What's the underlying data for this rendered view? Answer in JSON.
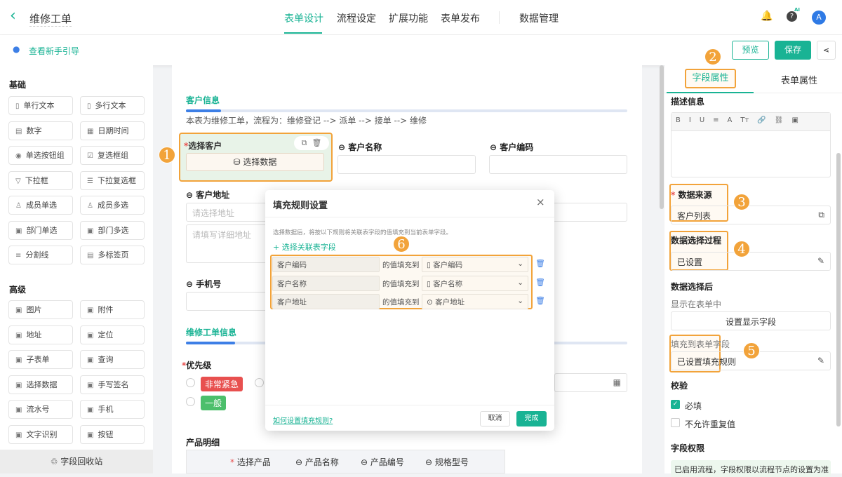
{
  "header": {
    "title": "维修工单",
    "tabs": [
      "表单设计",
      "流程设定",
      "扩展功能",
      "表单发布",
      "数据管理"
    ],
    "avatar": "A",
    "ai_badge": "AI"
  },
  "subheader": {
    "guide": "查看新手引导",
    "preview": "预览",
    "save": "保存"
  },
  "sidebar": {
    "basic_title": "基础",
    "basic": [
      [
        "单行文本",
        "多行文本"
      ],
      [
        "数字",
        "日期时间"
      ],
      [
        "单选按钮组",
        "复选框组"
      ],
      [
        "下拉框",
        "下拉复选框"
      ],
      [
        "成员单选",
        "成员多选"
      ],
      [
        "部门单选",
        "部门多选"
      ],
      [
        "分割线",
        "多标签页"
      ]
    ],
    "advanced_title": "高级",
    "advanced": [
      [
        "图片",
        "附件"
      ],
      [
        "地址",
        "定位"
      ],
      [
        "子表单",
        "查询"
      ],
      [
        "选择数据",
        "手写签名"
      ],
      [
        "流水号",
        "手机"
      ],
      [
        "文字识别",
        "按钮"
      ]
    ],
    "recycle": "字段回收站"
  },
  "form": {
    "section1": "客户信息",
    "desc": "本表为维修工单，流程为：维修登记 --> 派单 --> 接单 --> 维修",
    "select_customer": "选择客户",
    "select_data": "选择数据",
    "customer_name": "客户名称",
    "customer_code": "客户编码",
    "address": "客户地址",
    "address_ph": "请选择地址",
    "detail_ph": "请填写详细地址",
    "phone": "手机号",
    "section2": "维修工单信息",
    "priority": "优先级",
    "p_urgent": "非常紧急",
    "p_normal": "一般",
    "products": "产品明细",
    "product_cols": [
      "选择产品",
      "产品名称",
      "产品编号",
      "规格型号"
    ]
  },
  "modal": {
    "title": "填充规则设置",
    "hint": "选择数据后，将按以下规则将关联表字段的值填充到当前表单字段。",
    "add": "选择关联表字段",
    "rules": [
      {
        "src": "客户编码",
        "mid": "的值填充到",
        "dst": "客户编码"
      },
      {
        "src": "客户名称",
        "mid": "的值填充到",
        "dst": "客户名称"
      },
      {
        "src": "客户地址",
        "mid": "的值填充到",
        "dst": "客户地址"
      }
    ],
    "help": "如何设置填充规则?",
    "cancel": "取消",
    "ok": "完成"
  },
  "panel": {
    "tab_field": "字段属性",
    "tab_form": "表单属性",
    "desc_title": "描述信息",
    "toolbar": [
      "B",
      "I",
      "U",
      "≡",
      "A",
      "Tт",
      "🔗",
      "⛓",
      "▣"
    ],
    "source_label": "数据来源",
    "source_value": "客户列表",
    "process_label": "数据选择过程",
    "process_value": "已设置",
    "after_label": "数据选择后",
    "show_label": "显示在表单中",
    "show_btn": "设置显示字段",
    "fill_label": "填充到表单字段",
    "fill_value": "已设置填充规则",
    "validate": "校验",
    "required": "必填",
    "no_dup": "不允许重复值",
    "perm_title": "字段权限",
    "perm_note": "已启用流程，字段权限以流程节点的设置为准"
  },
  "badges": [
    "1",
    "2",
    "3",
    "4",
    "5",
    "6"
  ],
  "colors": {
    "accent": "#19b394",
    "highlight": "#f2a33a",
    "urgent": "#e8504f",
    "normal": "#4cbf6b"
  }
}
